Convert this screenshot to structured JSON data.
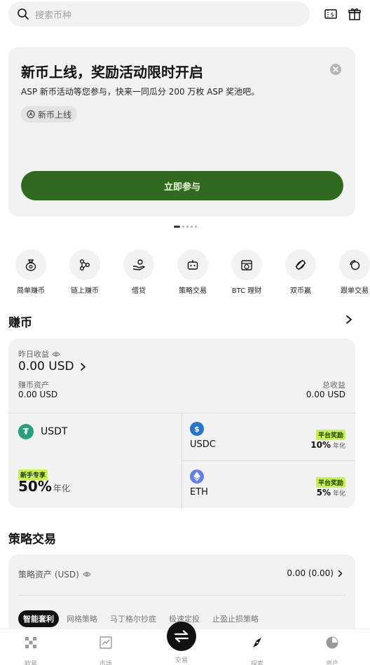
{
  "search": {
    "placeholder": "搜索币种"
  },
  "banner": {
    "title": "新币上线，奖励活动限时开启",
    "subtitle": "ASP 新币活动等您参与，快来一同瓜分 200 万枚 ASP 奖池吧。",
    "tag": "新币上线",
    "cta": "立即参与",
    "page_count": 5,
    "active_page": 1
  },
  "products": [
    {
      "label": "简单赚币",
      "icon": "money-bag-icon"
    },
    {
      "label": "链上赚币",
      "icon": "chain-nodes-icon"
    },
    {
      "label": "借贷",
      "icon": "hand-coin-icon"
    },
    {
      "label": "策略交易",
      "icon": "robot-icon"
    },
    {
      "label": "BTC 理财",
      "icon": "btc-calendar-icon"
    },
    {
      "label": "双币赢",
      "icon": "dual-coin-icon"
    },
    {
      "label": "跟单交易",
      "icon": "copy-trade-icon"
    }
  ],
  "earn": {
    "heading": "赚币",
    "yesterday_label": "昨日收益",
    "yesterday_value": "0.00 USD",
    "assets_label": "赚币资产",
    "assets_value": "0.00 USD",
    "total_label": "总收益",
    "total_value": "0.00 USD",
    "usdt": {
      "name": "USDT",
      "badge": "新手专享",
      "rate": "50%",
      "unit": "年化"
    },
    "usdc": {
      "name": "USDC",
      "badge": "平台奖励",
      "rate": "10%",
      "unit": "年化"
    },
    "eth": {
      "name": "ETH",
      "badge": "平台奖励",
      "rate": "5%",
      "unit": "年化"
    }
  },
  "strategy": {
    "heading": "策略交易",
    "assets_label": "策略资产 (USD)",
    "assets_value": "0.00 (0.00)",
    "tabs": [
      "智能套利",
      "网格策略",
      "马丁格尔抄底",
      "极速定投",
      "止盈止损策略"
    ],
    "active_tab": 0
  },
  "nav": {
    "items": [
      "欧易",
      "市场",
      "交易",
      "探索",
      "资产"
    ],
    "active": 3
  },
  "colors": {
    "brand_green": "#2f6a1e",
    "badge_lime": "#c7f24a",
    "usdt_green": "#26a17b",
    "usdc_blue": "#2775ca",
    "eth_blue": "#627eea"
  }
}
